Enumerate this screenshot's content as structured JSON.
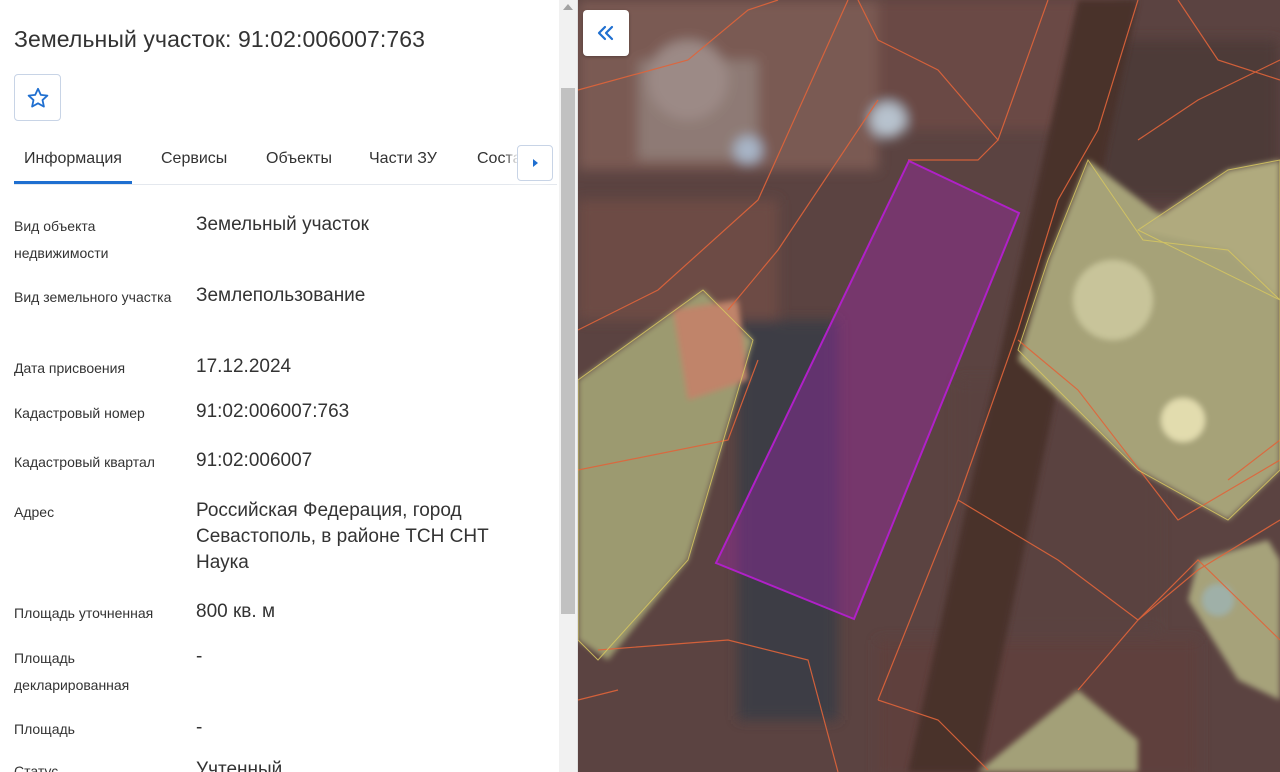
{
  "panel": {
    "title": "Земельный участок: 91:02:006007:763",
    "favorite_icon": "star-outline-icon",
    "tabs": [
      {
        "label": "Информация",
        "active": true
      },
      {
        "label": "Сервисы",
        "active": false
      },
      {
        "label": "Объекты",
        "active": false
      },
      {
        "label": "Части ЗУ",
        "active": false
      },
      {
        "label": "Состав",
        "active": false
      }
    ],
    "tabs_next_icon": "chevron-right-icon",
    "fields": [
      {
        "label": "Вид объекта недвижимости",
        "value": "Земельный участок"
      },
      {
        "label": "Вид земельного участка",
        "value": "Землепользование"
      },
      {
        "label": "Дата присвоения",
        "value": "17.12.2024"
      },
      {
        "label": "Кадастровый номер",
        "value": "91:02:006007:763"
      },
      {
        "label": "Кадастровый квартал",
        "value": "91:02:006007"
      },
      {
        "label": "Адрес",
        "value": "Российская Федерация, город Севастополь, в районе ТСН СНТ Наука"
      },
      {
        "label": "Площадь уточненная",
        "value": "800 кв. м"
      },
      {
        "label": "Площадь декларированная",
        "value": "-"
      },
      {
        "label": "Площадь",
        "value": "-"
      },
      {
        "label": "Статус",
        "value": "Учтенный"
      }
    ]
  },
  "map": {
    "collapse_icon": "double-chevron-left-icon",
    "highlight_color": "#b020c8",
    "parcel_border_color": "#e0643a"
  },
  "colors": {
    "accent": "#1f6fd0",
    "text": "#333333"
  }
}
